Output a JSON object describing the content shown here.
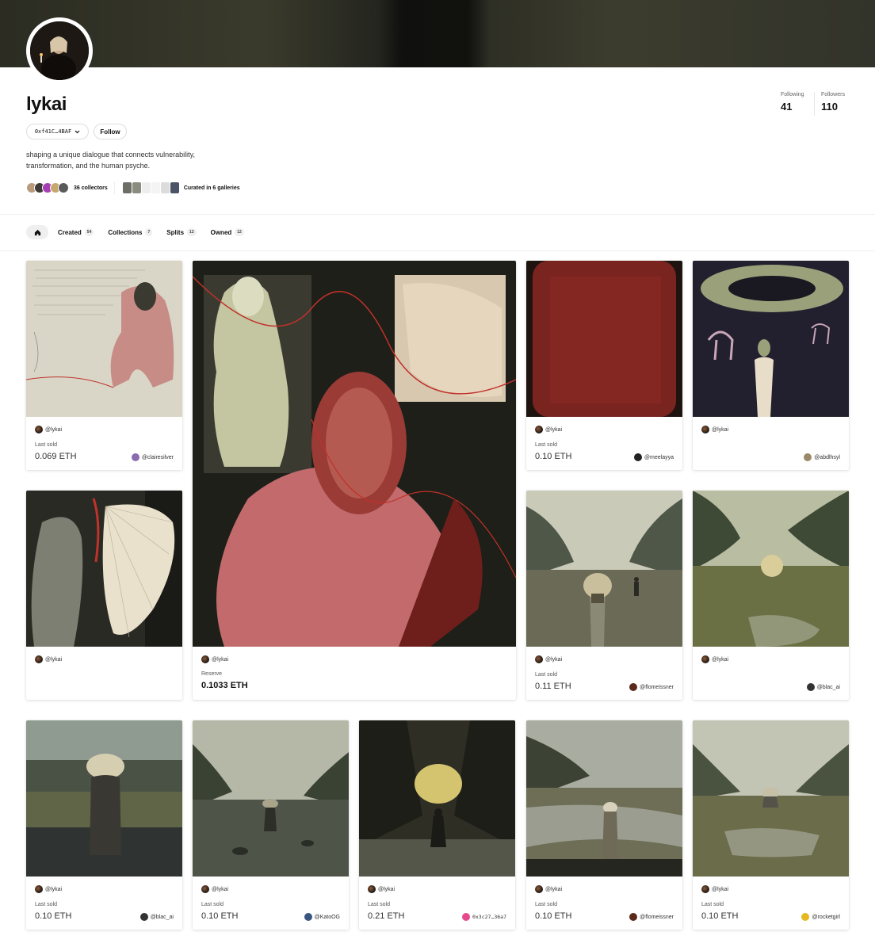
{
  "profile": {
    "username": "lykai",
    "address": "0xf41C…4BAF",
    "follow_label": "Follow",
    "bio": "shaping a unique dialogue that connects vulnerability, transformation, and the human psyche.",
    "collectors_label": "36 collectors",
    "galleries_label": "Curated in 6 galleries",
    "following_label": "Following",
    "following_count": "41",
    "followers_label": "Followers",
    "followers_count": "110"
  },
  "tabs": [
    {
      "label": "Created",
      "count": "54"
    },
    {
      "label": "Collections",
      "count": "7"
    },
    {
      "label": "Splits",
      "count": "12"
    },
    {
      "label": "Owned",
      "count": "12"
    }
  ],
  "cards": [
    {
      "creator": "@lykai",
      "label": "Last sold",
      "price": "0.069 ETH",
      "owner": "@clairesilver"
    },
    {
      "creator": "@lykai",
      "label": "Reserve",
      "price": "0.1033 ETH",
      "owner": ""
    },
    {
      "creator": "@lykai",
      "label": "Last sold",
      "price": "0.10 ETH",
      "owner": "@meelayya"
    },
    {
      "creator": "@lykai",
      "label": "",
      "price": "",
      "owner": "@abdlhsyl"
    },
    {
      "creator": "@lykai",
      "label": "",
      "price": "",
      "owner": ""
    },
    {
      "creator": "@lykai",
      "label": "Last sold",
      "price": "0.11 ETH",
      "owner": "@flomeissner"
    },
    {
      "creator": "@lykai",
      "label": "",
      "price": "",
      "owner": "@blac_ai"
    },
    {
      "creator": "@lykai",
      "label": "Last sold",
      "price": "0.10 ETH",
      "owner": "@blac_ai"
    },
    {
      "creator": "@lykai",
      "label": "Last sold",
      "price": "0.10 ETH",
      "owner": "@KatoOG"
    },
    {
      "creator": "@lykai",
      "label": "Last sold",
      "price": "0.21 ETH",
      "owner": "0x3c27…36a7"
    },
    {
      "creator": "@lykai",
      "label": "Last sold",
      "price": "0.10 ETH",
      "owner": "@flomeissner"
    },
    {
      "creator": "@lykai",
      "label": "Last sold",
      "price": "0.10 ETH",
      "owner": "@rocketgirl"
    }
  ],
  "icons": {
    "home": "home-icon",
    "chevron": "chevron-down-icon"
  }
}
